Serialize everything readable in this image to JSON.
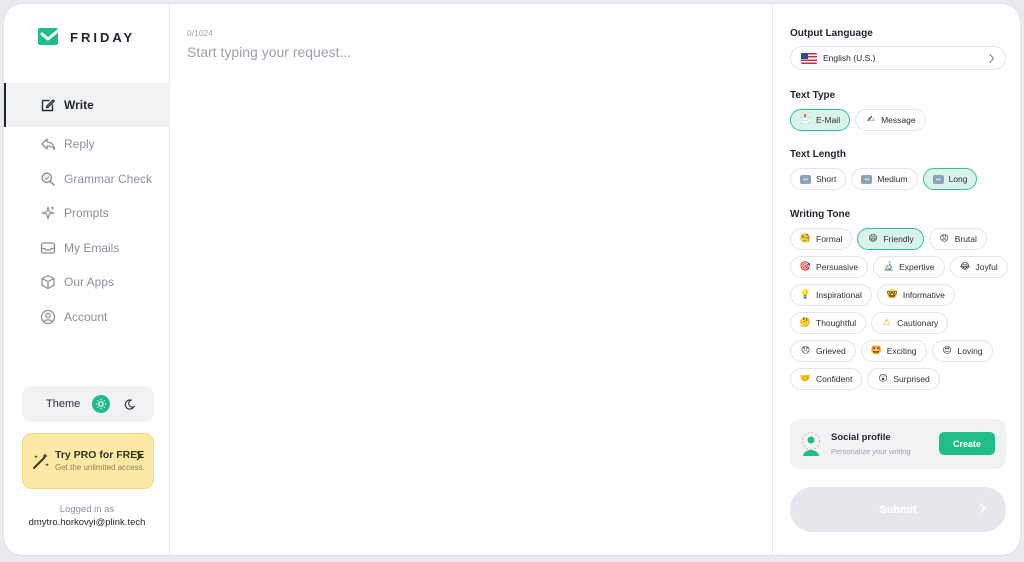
{
  "app": {
    "name": "FRIDAY"
  },
  "sidebar": {
    "items": [
      {
        "label": "Write",
        "icon": "edit-icon",
        "active": true
      },
      {
        "label": "Reply",
        "icon": "reply-icon",
        "active": false
      },
      {
        "label": "Grammar Check",
        "icon": "magnifier-icon",
        "active": false
      },
      {
        "label": "Prompts",
        "icon": "sparkle-icon",
        "active": false
      },
      {
        "label": "My Emails",
        "icon": "inbox-icon",
        "active": false
      },
      {
        "label": "Our Apps",
        "icon": "box-icon",
        "active": false
      },
      {
        "label": "Account",
        "icon": "user-circle-icon",
        "active": false
      }
    ],
    "theme_label": "Theme",
    "pro": {
      "title": "Try PRO for FREE",
      "subtitle": "Get the unlimited access."
    },
    "logged_in_label": "Logged in as",
    "email": "dmytro.horkovyi@plink.tech"
  },
  "editor": {
    "counter": "0/1024",
    "placeholder": "Start typing your request..."
  },
  "panel": {
    "output_language": {
      "title": "Output Language",
      "value": "English (U.S.)"
    },
    "text_type": {
      "title": "Text Type",
      "options": [
        {
          "label": "E-Mail",
          "emoji": "📩",
          "selected": true
        },
        {
          "label": "Message",
          "emoji": "✍",
          "selected": false
        }
      ]
    },
    "text_length": {
      "title": "Text Length",
      "options": [
        {
          "label": "Short",
          "emoji": "↔",
          "selected": false
        },
        {
          "label": "Medium",
          "emoji": "↔",
          "selected": false
        },
        {
          "label": "Long",
          "emoji": "↔",
          "selected": true
        }
      ]
    },
    "writing_tone": {
      "title": "Writing Tone",
      "options": [
        {
          "label": "Formal",
          "emoji": "🧐",
          "selected": false
        },
        {
          "label": "Friendly",
          "emoji": "😄",
          "selected": true
        },
        {
          "label": "Brutal",
          "emoji": "😡",
          "selected": false
        },
        {
          "label": "Persuasive",
          "emoji": "🎯",
          "selected": false
        },
        {
          "label": "Expertive",
          "emoji": "🔬",
          "selected": false
        },
        {
          "label": "Joyful",
          "emoji": "😂",
          "selected": false
        },
        {
          "label": "Inspirational",
          "emoji": "💡",
          "selected": false
        },
        {
          "label": "Informative",
          "emoji": "🤓",
          "selected": false
        },
        {
          "label": "Thoughtful",
          "emoji": "🤔",
          "selected": false
        },
        {
          "label": "Cautionary",
          "emoji": "⚠",
          "selected": false
        },
        {
          "label": "Grieved",
          "emoji": "😞",
          "selected": false
        },
        {
          "label": "Exciting",
          "emoji": "🤩",
          "selected": false
        },
        {
          "label": "Loving",
          "emoji": "😍",
          "selected": false
        },
        {
          "label": "Confident",
          "emoji": "🤝",
          "selected": false
        },
        {
          "label": "Surprised",
          "emoji": "😲",
          "selected": false
        }
      ]
    },
    "social": {
      "title": "Social profile",
      "subtitle": "Personalize your writing",
      "button": "Create"
    },
    "submit": {
      "label": "Submit"
    }
  },
  "colors": {
    "accent": "#1fbe86",
    "selected_chip_bg": "#d8f3e8",
    "pro_bg": "#fde9a6"
  }
}
